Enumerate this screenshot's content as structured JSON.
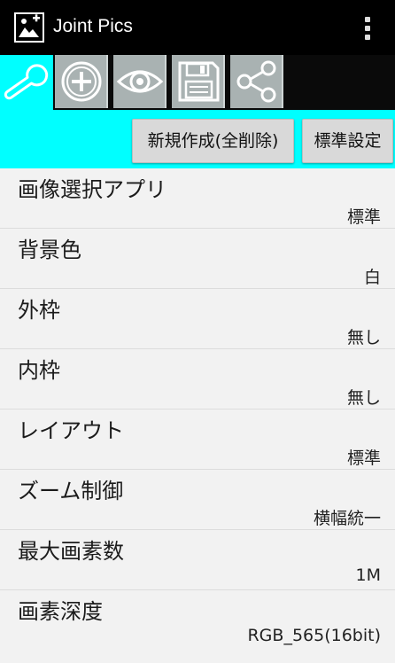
{
  "app": {
    "title": "Joint Pics",
    "icon": "image-plus-icon",
    "menu_icon": "overflow-menu-icon"
  },
  "toolbar": {
    "tabs": [
      {
        "name": "settings",
        "icon": "wrench-icon"
      },
      {
        "name": "add",
        "icon": "add-circle-icon"
      },
      {
        "name": "preview",
        "icon": "eye-icon"
      },
      {
        "name": "save",
        "icon": "floppy-disk-icon"
      },
      {
        "name": "share",
        "icon": "share-icon"
      }
    ],
    "new_button": "新規作成(全削除)",
    "default_button": "標準設定"
  },
  "settings": [
    {
      "label": "画像選択アプリ",
      "value": "標準"
    },
    {
      "label": "背景色",
      "value": "白"
    },
    {
      "label": "外枠",
      "value": "無し"
    },
    {
      "label": "内枠",
      "value": "無し"
    },
    {
      "label": "レイアウト",
      "value": "標準"
    },
    {
      "label": "ズーム制御",
      "value": "横幅統一"
    },
    {
      "label": "最大画素数",
      "value": "1M"
    },
    {
      "label": "画素深度",
      "value": "RGB_565(16bit)"
    }
  ],
  "colors": {
    "accent": "#00ffff",
    "appbar": "#000000",
    "tab_inactive": "#a9b2b2"
  }
}
